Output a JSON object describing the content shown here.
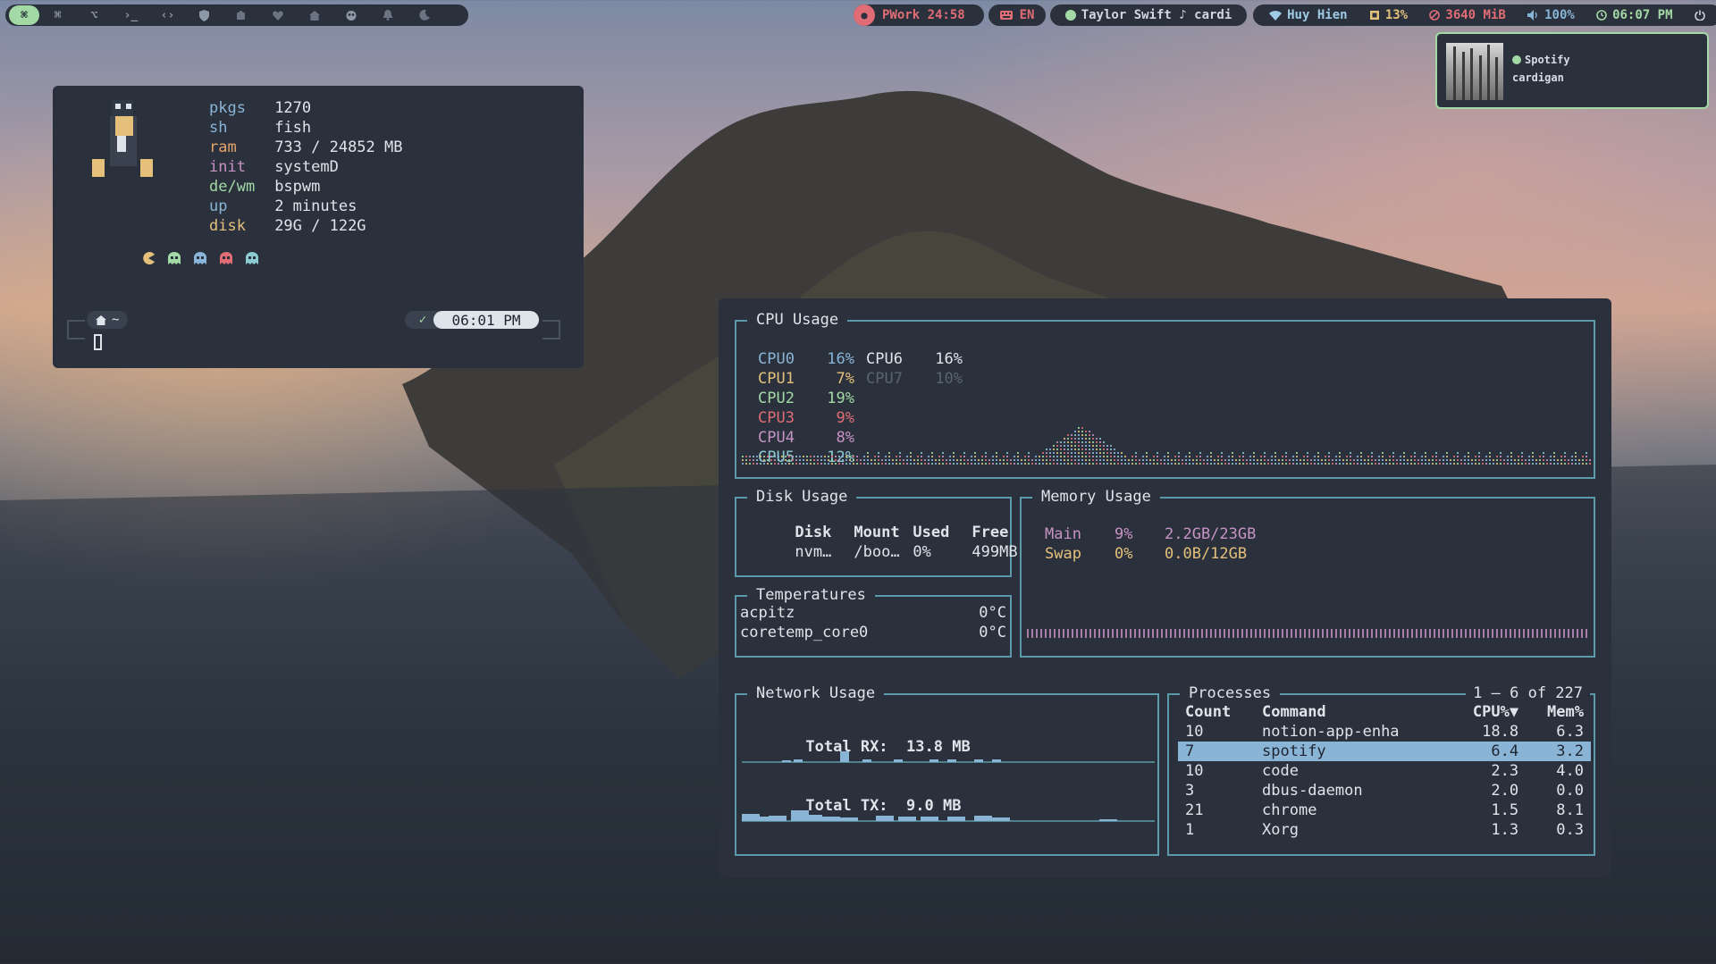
{
  "topbar": {
    "workspace_icons": [
      "command-icon",
      "command-icon",
      "option-icon",
      "terminal-icon",
      "code-icon",
      "shield-icon",
      "puzzle-icon",
      "heart-icon",
      "home-icon",
      "owl-icon",
      "bell-icon",
      "moon-icon"
    ],
    "ws_command": "⌘",
    "ws_option": "⌥",
    "ws_terminal": "›_",
    "ws_code": "‹›",
    "pomodoro": "PWork 24:58",
    "language": "EN",
    "music": "Taylor Swift ♪ cardi",
    "wifi": "Huy Hien",
    "cpu": "13%",
    "memory": "3640 MiB",
    "volume": "100%",
    "time": "06:07 PM"
  },
  "notification": {
    "app": "Spotify",
    "title": "cardigan"
  },
  "fetch": {
    "rows": [
      {
        "key": "pkgs",
        "value": "1270",
        "color": "#89b4d6"
      },
      {
        "key": "sh",
        "value": "fish",
        "color": "#89b4d6"
      },
      {
        "key": "ram",
        "value": "733 / 24852 MB",
        "color": "#e5a46b"
      },
      {
        "key": "init",
        "value": "systemD",
        "color": "#c792c4"
      },
      {
        "key": "de/wm",
        "value": "bspwm",
        "color": "#a3d9a5"
      },
      {
        "key": "up",
        "value": "2 minutes",
        "color": "#89b4d6"
      },
      {
        "key": "disk",
        "value": "29G / 122G",
        "color": "#e5c07b"
      }
    ],
    "ghost_colors": [
      "#e5c07b",
      "#a3d9a5",
      "#89b4d6",
      "#e06c75",
      "#8ccbd0"
    ],
    "prompt_dir": "~",
    "prompt_time": "06:01 PM"
  },
  "btop": {
    "cpu": {
      "title": "CPU Usage",
      "cores": [
        {
          "name": "CPU0",
          "value": "16%",
          "color": "#89b4d6"
        },
        {
          "name": "CPU1",
          "value": "7%",
          "color": "#e5c07b"
        },
        {
          "name": "CPU2",
          "value": "19%",
          "color": "#a3d9a5"
        },
        {
          "name": "CPU3",
          "value": "9%",
          "color": "#e06c75"
        },
        {
          "name": "CPU4",
          "value": "8%",
          "color": "#c792c4"
        },
        {
          "name": "CPU5",
          "value": "12%",
          "color": "#8ccbd0"
        },
        {
          "name": "CPU6",
          "value": "16%",
          "color": "#dfe4ea"
        },
        {
          "name": "CPU7",
          "value": "10%",
          "color": "#5a6372"
        }
      ]
    },
    "disk": {
      "title": "Disk Usage",
      "headers": [
        "Disk",
        "Mount",
        "Used",
        "Free"
      ],
      "rows": [
        [
          "nvm…",
          "/boo…",
          "0%",
          "499MB"
        ]
      ]
    },
    "temps": {
      "title": "Temperatures",
      "rows": [
        [
          "acpitz",
          "0°C"
        ],
        [
          "coretemp_core0",
          "0°C"
        ]
      ]
    },
    "memory": {
      "title": "Memory Usage",
      "rows": [
        {
          "name": "Main",
          "pct": "9%",
          "amount": "2.2GB/23GB",
          "color": "#c792c4"
        },
        {
          "name": "Swap",
          "pct": "0%",
          "amount": "0.0B/12GB",
          "color": "#e5c07b"
        }
      ]
    },
    "network": {
      "title": "Network Usage",
      "rx_label": "Total RX:",
      "rx_value": "13.8 MB",
      "tx_label": "Total TX:",
      "tx_value": "9.0 MB"
    },
    "processes": {
      "title": "Processes",
      "range": "1 – 6 of 227",
      "headers": [
        "Count",
        "Command",
        "CPU%▼",
        "Mem%"
      ],
      "rows": [
        [
          "10",
          "notion-app-enha",
          "18.8",
          "6.3"
        ],
        [
          "7",
          "spotify",
          "6.4",
          "3.2"
        ],
        [
          "10",
          "code",
          "2.3",
          "4.0"
        ],
        [
          "3",
          "dbus-daemon",
          "2.0",
          "0.0"
        ],
        [
          "21",
          "chrome",
          "1.5",
          "8.1"
        ],
        [
          "1",
          "Xorg",
          "1.3",
          "0.3"
        ]
      ],
      "selected_index": 1
    }
  }
}
